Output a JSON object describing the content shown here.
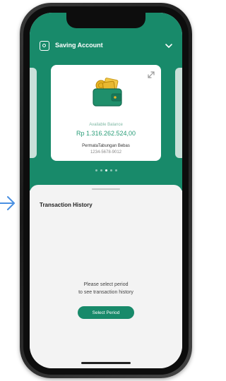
{
  "header": {
    "title": "Saving Account"
  },
  "card": {
    "balance_label": "Available Balance",
    "balance_value": "Rp 1.316.262.524,00",
    "account_name": "PermataTabungan Bebas",
    "account_number": "1234-5678-9012"
  },
  "carousel": {
    "active_page": 3,
    "total_pages": 5
  },
  "transactions": {
    "title": "Transaction History",
    "empty_line1": "Please select period",
    "empty_line2": "to see transaction history",
    "button_label": "Select Period"
  },
  "icons": {
    "header": "wallet-card-icon",
    "chevron": "chevron-down-icon",
    "expand": "expand-icon",
    "illustration": "wallet-illustration",
    "pointer": "arrow-right-icon"
  },
  "colors": {
    "brand_green": "#188a6a",
    "balance_text": "#2a9d78",
    "sheet_bg": "#f3f3f3"
  }
}
